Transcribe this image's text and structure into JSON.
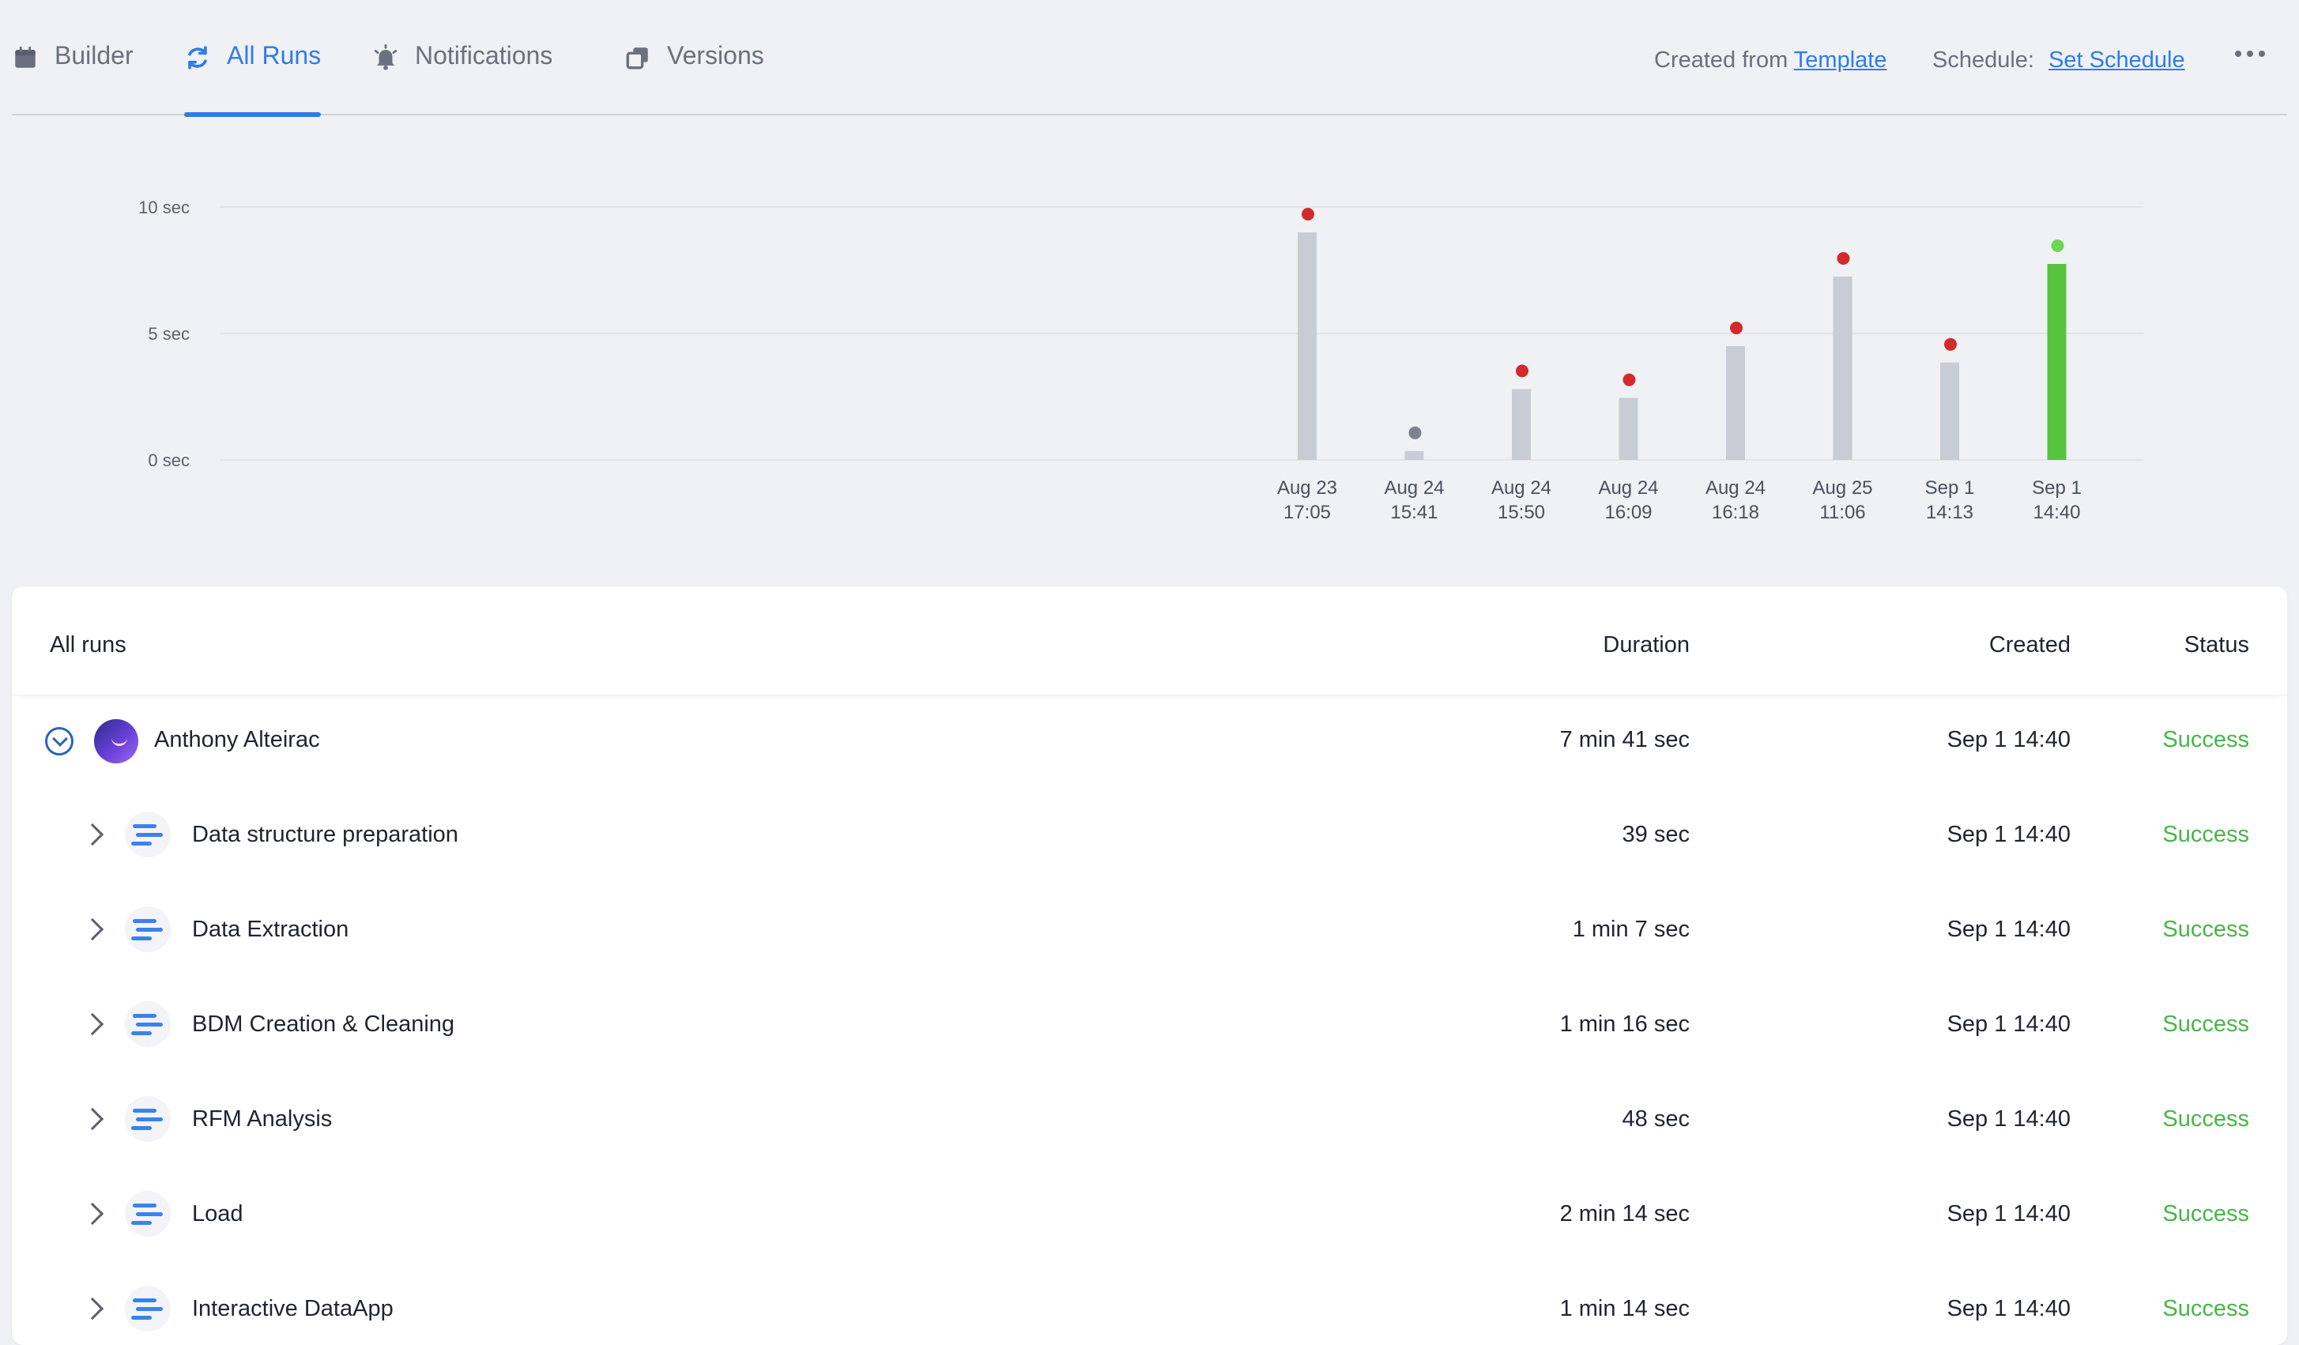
{
  "nav": {
    "tabs": [
      {
        "label": "Builder",
        "icon": "calendar-icon",
        "active": false
      },
      {
        "label": "All Runs",
        "icon": "refresh-icon",
        "active": true
      },
      {
        "label": "Notifications",
        "icon": "bell-icon",
        "active": false
      },
      {
        "label": "Versions",
        "icon": "copy-icon",
        "active": false
      }
    ],
    "created_from_label": "Created from",
    "created_from_link": "Template",
    "schedule_label": "Schedule:",
    "schedule_link": "Set Schedule",
    "more_icon": "more-horizontal-icon"
  },
  "chart_data": {
    "type": "bar",
    "title": "",
    "xlabel": "",
    "ylabel": "",
    "ylim": [
      0,
      10
    ],
    "yticks": [
      "0 sec",
      "5 sec",
      "10 sec"
    ],
    "categories": [
      [
        "Aug 23",
        "17:05"
      ],
      [
        "Aug 24",
        "15:41"
      ],
      [
        "Aug 24",
        "15:50"
      ],
      [
        "Aug 24",
        "16:09"
      ],
      [
        "Aug 24",
        "16:18"
      ],
      [
        "Aug 25",
        "11:06"
      ],
      [
        "Sep 1",
        "14:13"
      ],
      [
        "Sep 1",
        "14:40"
      ]
    ],
    "values": [
      9.0,
      0.35,
      2.8,
      2.45,
      4.5,
      7.25,
      3.85,
      7.75
    ],
    "status": [
      "failed",
      "other",
      "failed",
      "failed",
      "failed",
      "failed",
      "failed",
      "success"
    ],
    "colors": {
      "bar": "#c8ccd4",
      "bar_success": "#57c43f",
      "dot_failed": "#d42a2a",
      "dot_other": "#7c8290",
      "dot_success": "#6bd94f",
      "grid": "#e2e4e8"
    },
    "grid": true
  },
  "table": {
    "headers": {
      "name": "All runs",
      "duration": "Duration",
      "created": "Created",
      "status": "Status"
    },
    "parent": {
      "name": "Anthony Alteirac",
      "duration": "7 min 41 sec",
      "created": "Sep 1 14:40",
      "status": "Success"
    },
    "rows": [
      {
        "name": "Data structure preparation",
        "duration": "39 sec",
        "created": "Sep 1 14:40",
        "status": "Success"
      },
      {
        "name": "Data Extraction",
        "duration": "1 min 7 sec",
        "created": "Sep 1 14:40",
        "status": "Success"
      },
      {
        "name": "BDM Creation & Cleaning",
        "duration": "1 min 16 sec",
        "created": "Sep 1 14:40",
        "status": "Success"
      },
      {
        "name": "RFM Analysis",
        "duration": "48 sec",
        "created": "Sep 1 14:40",
        "status": "Success"
      },
      {
        "name": "Load",
        "duration": "2 min 14 sec",
        "created": "Sep 1 14:40",
        "status": "Success"
      },
      {
        "name": "Interactive DataApp",
        "duration": "1 min 14 sec",
        "created": "Sep 1 14:40",
        "status": "Success"
      }
    ]
  }
}
